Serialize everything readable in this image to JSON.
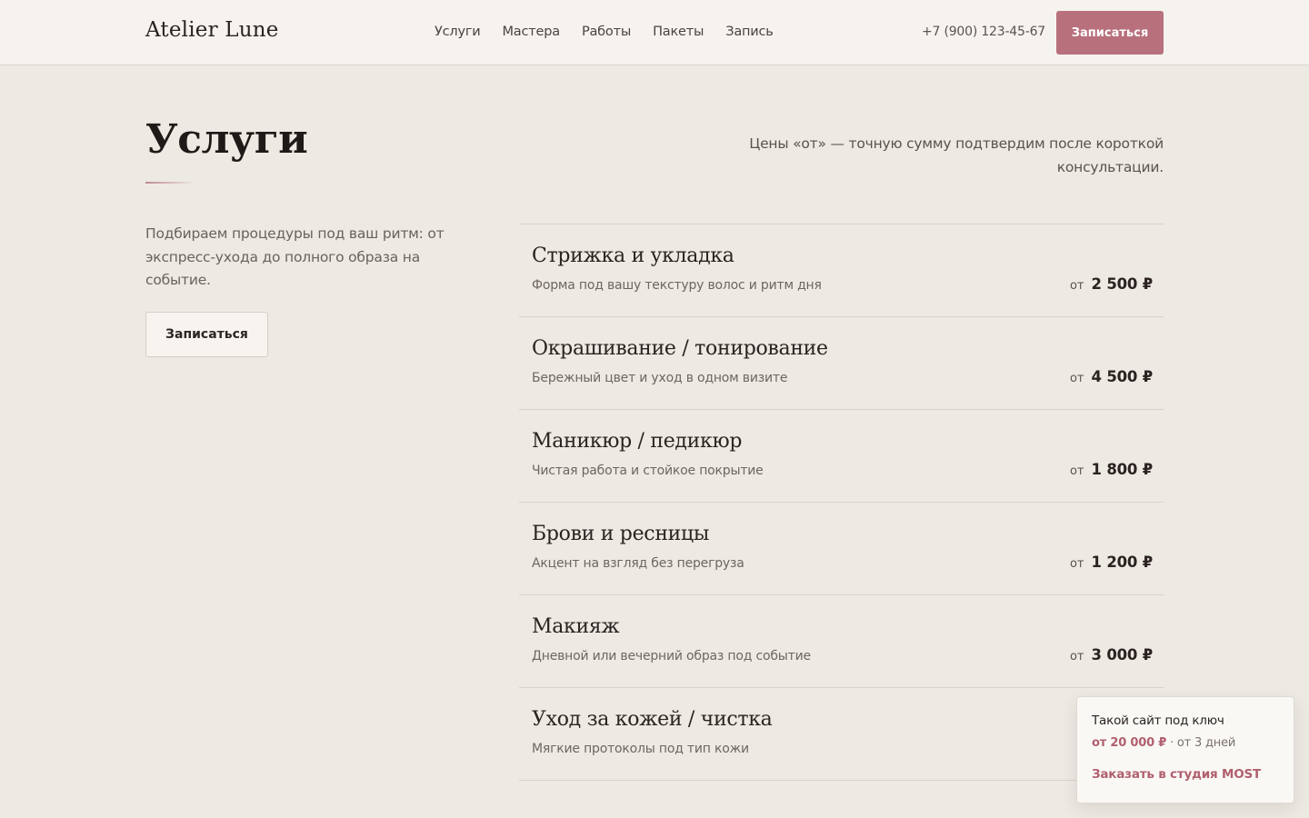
{
  "header": {
    "logo": "Atelier Lune",
    "nav": [
      "Услуги",
      "Мастера",
      "Работы",
      "Пакеты",
      "Запись"
    ],
    "phone": "+7 (900) 123-45-67",
    "cta_label": "Записаться"
  },
  "page": {
    "title": "Услуги",
    "price_note": "Цены «от» — точную сумму подтвердим после короткой консультации.",
    "intro": "Подбираем процедуры под ваш ритм: от экспресс-ухода до полного образа на событие.",
    "intro_button": "Записаться"
  },
  "services": [
    {
      "name": "Стрижка и укладка",
      "desc": "Форма под вашу текстуру волос и ритм дня",
      "from": "от",
      "price": "2 500 ₽"
    },
    {
      "name": "Окрашивание / тонирование",
      "desc": "Бережный цвет и уход в одном визите",
      "from": "от",
      "price": "4 500 ₽"
    },
    {
      "name": "Маникюр / педикюр",
      "desc": "Чистая работа и стойкое покрытие",
      "from": "от",
      "price": "1 800 ₽"
    },
    {
      "name": "Брови и ресницы",
      "desc": "Акцент на взгляд без перегруза",
      "from": "от",
      "price": "1 200 ₽"
    },
    {
      "name": "Макияж",
      "desc": "Дневной или вечерний образ под событие",
      "from": "от",
      "price": "3 000 ₽"
    },
    {
      "name": "Уход за кожей / чистка",
      "desc": "Мягкие протоколы под тип кожи",
      "from": "",
      "price": ""
    }
  ],
  "promo": {
    "title": "Такой сайт под ключ",
    "price": "от 20 000 ₽",
    "days": "· от 3 дней",
    "link": "Заказать в студия MOST"
  },
  "colors": {
    "accent": "#b8707c",
    "background": "#ede9e3",
    "header_bg": "#f6f3ef"
  }
}
